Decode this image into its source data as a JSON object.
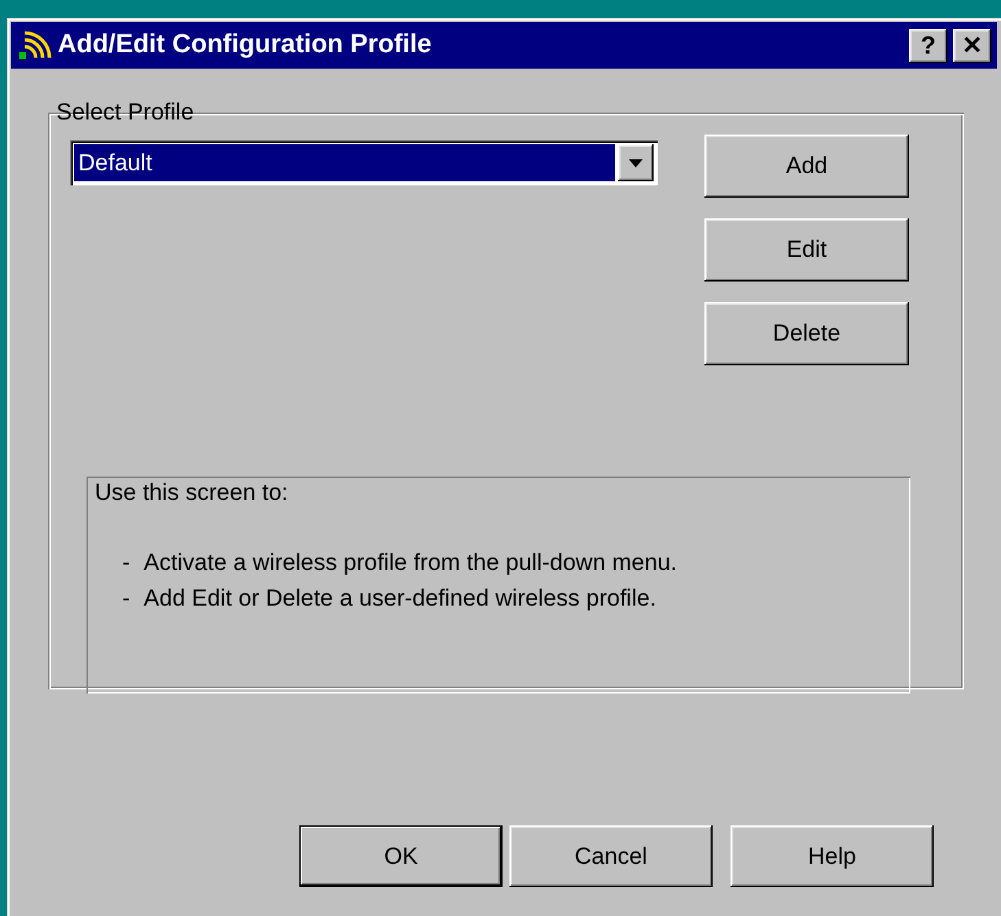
{
  "window": {
    "title": "Add/Edit Configuration Profile",
    "title_buttons": [
      "?",
      "✕"
    ]
  },
  "select_profile": {
    "legend": "Select Profile",
    "profile": {
      "value": "Default"
    },
    "buttons": [
      "Add",
      "Edit",
      "Delete"
    ],
    "help": {
      "heading": "Use this screen to:",
      "items": [
        {
          "marker": "-",
          "text": "Activate a wireless profile from the pull-down menu."
        },
        {
          "marker": "-",
          "text": "Add Edit or Delete a user-defined wireless profile."
        }
      ]
    }
  },
  "buttons": [
    {
      "label": "OK",
      "default": true
    },
    {
      "label": "Cancel",
      "default": false
    },
    {
      "label": "Help",
      "default": false
    }
  ]
}
